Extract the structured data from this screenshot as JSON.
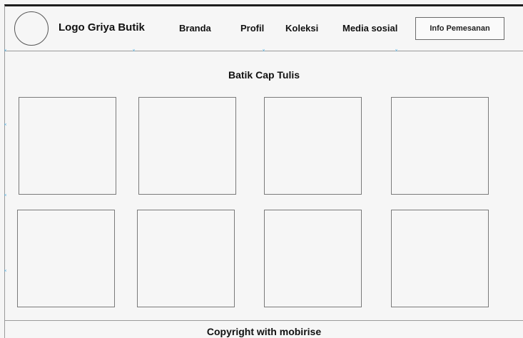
{
  "header": {
    "logo_text": "Logo Griya Butik",
    "nav": {
      "branda": "Branda",
      "profil": "Profil",
      "koleksi": "Koleksi",
      "media_sosial": "Media sosial"
    },
    "order_button": "Info Pemesanan"
  },
  "main": {
    "section_title": "Batik Cap Tulis",
    "tile_count": 8
  },
  "footer": {
    "copyright": "Copyright with mobirise"
  },
  "colors": {
    "background": "#f6f6f6",
    "border": "#7a7a7a",
    "handle": "#5fb8e6"
  }
}
